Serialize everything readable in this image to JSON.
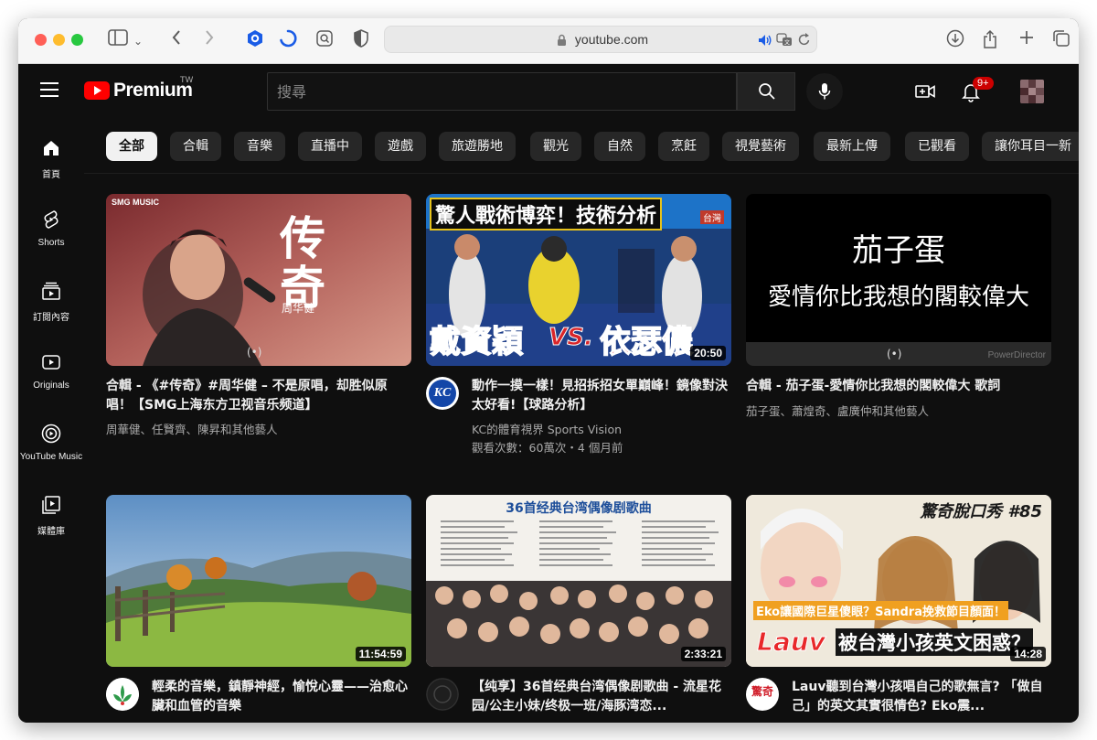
{
  "browser": {
    "url": "youtube.com",
    "colors": {
      "close": "#ff5f57",
      "minimize": "#febc2e",
      "maximize": "#28c840"
    }
  },
  "header": {
    "logo_text": "Premium",
    "region": "TW",
    "search_placeholder": "搜尋",
    "notification_count": "9+"
  },
  "sidebar": {
    "items": [
      {
        "label": "首頁",
        "icon": "home-icon"
      },
      {
        "label": "Shorts",
        "icon": "shorts-icon"
      },
      {
        "label": "訂閱內容",
        "icon": "subscriptions-icon"
      },
      {
        "label": "Originals",
        "icon": "originals-icon"
      },
      {
        "label": "YouTube Music",
        "icon": "music-icon"
      },
      {
        "label": "媒體庫",
        "icon": "library-icon"
      }
    ]
  },
  "chips": [
    "全部",
    "合輯",
    "音樂",
    "直播中",
    "遊戲",
    "旅遊勝地",
    "觀光",
    "自然",
    "烹飪",
    "視覺藝術",
    "最新上傳",
    "已觀看",
    "讓你耳目一新"
  ],
  "videos": [
    {
      "title": "合輯 - 《#传奇》#周华健 – 不是原唱，却胜似原唱！【SMG上海东方卫视音乐频道】",
      "meta1": "周華健、任賢齊、陳昇和其他藝人",
      "meta2": "",
      "duration": "",
      "thumb_badge": "SMG MUSIC",
      "thumb_title": "传奇",
      "thumb_sub": "周华健"
    },
    {
      "title": "動作一摸一樣！見招拆招女單巔峰！鏡像對決太好看!【球路分析】",
      "meta1": "KC的體育視界 Sports Vision",
      "meta2": "觀看次數：60萬次・4 個月前",
      "duration": "20:50",
      "channel_avatar_text": "KC",
      "thumb_top": "驚人戰術博弈！技術分析",
      "thumb_bottom_left": "戴資穎",
      "thumb_vs": "VS.",
      "thumb_bottom_right": "依瑟儂",
      "thumb_corner": "台灣"
    },
    {
      "title": "合輯 - 茄子蛋-愛情你比我想的閣較偉大 歌詞",
      "meta1": "茄子蛋、蕭煌奇、盧廣仲和其他藝人",
      "meta2": "",
      "duration": "",
      "thumb_line1": "茄子蛋",
      "thumb_line2": "愛情你比我想的閣較偉大",
      "thumb_watermark": "PowerDirector"
    },
    {
      "title": "輕柔的音樂，鎮靜神經，愉悅心靈——治愈心臟和血管的音樂",
      "duration": "11:54:59"
    },
    {
      "title": "【纯享】36首经典台湾偶像剧歌曲 - 流星花园/公主小妹/终极一班/海豚湾恋...",
      "duration": "2:33:21",
      "thumb_title": "36首经典台湾偶像剧歌曲"
    },
    {
      "title": "Lauv聽到台灣小孩唱自己的歌無言? 「做自己」的英文其實很情色? Eko震...",
      "duration": "14:28",
      "thumb_top": "驚奇脫口秀 #85",
      "thumb_mid": "Eko讓國際巨星傻眼？Sandra挽救節目顏面！",
      "thumb_bottom_left": "Lauv",
      "thumb_bottom_right": "被台灣小孩英文困惑？",
      "channel_avatar_text": "驚奇"
    }
  ]
}
